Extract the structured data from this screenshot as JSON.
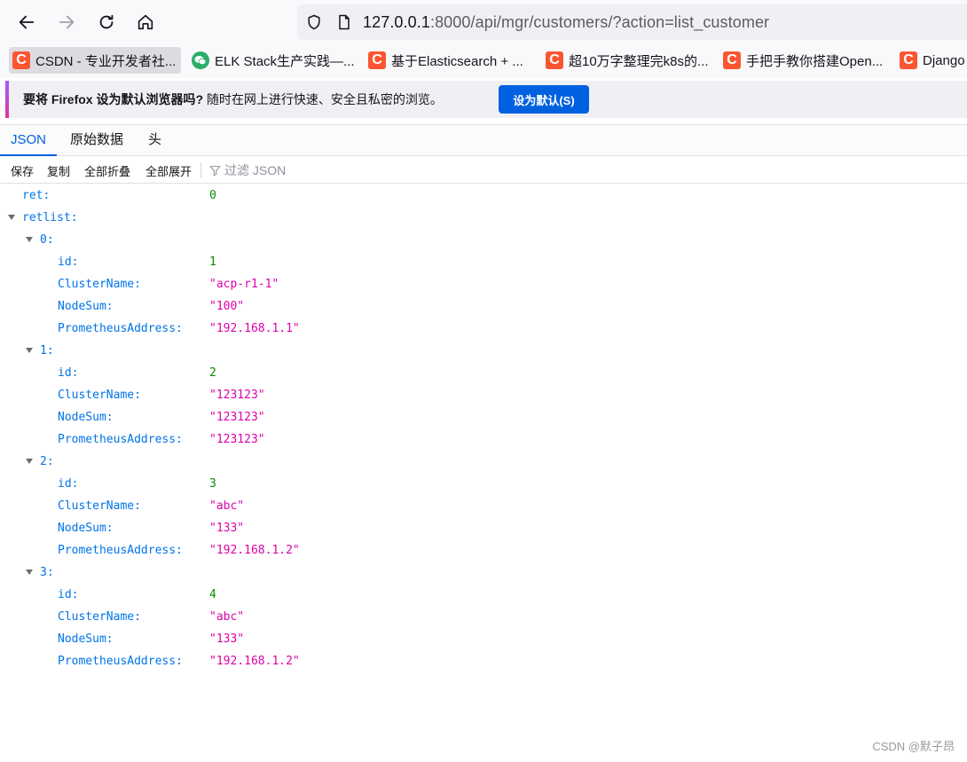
{
  "url": {
    "host": "127.0.0.1",
    "rest": ":8000/api/mgr/customers/?action=list_customer"
  },
  "bookmarks": [
    {
      "label": "CSDN - 专业开发者社...",
      "icon": "csdn-icon"
    },
    {
      "label": "ELK Stack生产实践—...",
      "icon": "wechat-icon"
    },
    {
      "label": "基于Elasticsearch + ...",
      "icon": "csdn-icon"
    },
    {
      "label": "超10万字整理完k8s的...",
      "icon": "csdn-icon"
    },
    {
      "label": "手把手教你搭建Open...",
      "icon": "csdn-icon"
    },
    {
      "label": "Django",
      "icon": "csdn-icon"
    }
  ],
  "notification": {
    "prefix": "要将 ",
    "brand": "Firefox",
    "question": " 设为默认浏览器吗?",
    "detail": " 随时在网上进行快速、安全且私密的浏览。",
    "button": "设为默认(S)"
  },
  "tabs": [
    "JSON",
    "原始数据",
    "头"
  ],
  "toolbar": {
    "save": "保存",
    "copy": "复制",
    "collapse_all": "全部折叠",
    "expand_all": "全部展开",
    "filter_placeholder": "过滤 JSON"
  },
  "json": {
    "ret_key": "ret:",
    "ret_value": "0",
    "retlist_key": "retlist:",
    "items": [
      {
        "index": "0:",
        "id": "1",
        "ClusterName": "\"acp-r1-1\"",
        "NodeSum": "\"100\"",
        "PrometheusAddress": "\"192.168.1.1\""
      },
      {
        "index": "1:",
        "id": "2",
        "ClusterName": "\"123123\"",
        "NodeSum": "\"123123\"",
        "PrometheusAddress": "\"123123\""
      },
      {
        "index": "2:",
        "id": "3",
        "ClusterName": "\"abc\"",
        "NodeSum": "\"133\"",
        "PrometheusAddress": "\"192.168.1.2\""
      },
      {
        "index": "3:",
        "id": "4",
        "ClusterName": "\"abc\"",
        "NodeSum": "\"133\"",
        "PrometheusAddress": "\"192.168.1.2\""
      }
    ],
    "field_keys": {
      "id": "id:",
      "ClusterName": "ClusterName:",
      "NodeSum": "NodeSum:",
      "PrometheusAddress": "PrometheusAddress:"
    }
  },
  "watermark": "CSDN @默子昂",
  "colors": {
    "accent": "#0060df",
    "key": "#0074e8",
    "number": "#058b00",
    "string": "#dd00a9",
    "csdn": "#fc5531"
  }
}
